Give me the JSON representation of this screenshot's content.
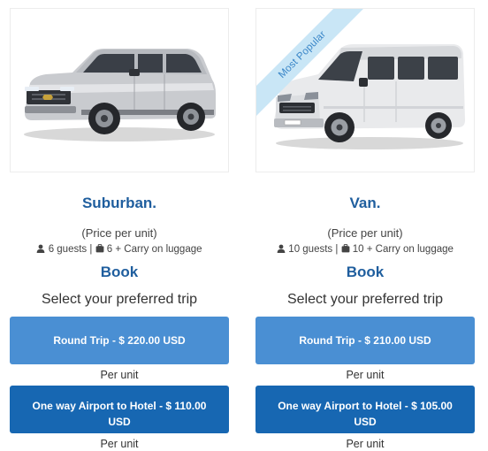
{
  "colors": {
    "title": "#1f5e9e",
    "round_trip_button": "#4a8fd3",
    "one_way_button": "#1767b2",
    "ribbon_bg": "#c9e6f6",
    "ribbon_text": "#3a86c8"
  },
  "icons": {
    "guests": "user-icon",
    "luggage": "suitcase-icon"
  },
  "cards": [
    {
      "title": "Suburban.",
      "price_note": "(Price per unit)",
      "guests": "6 guests",
      "separator": "|",
      "luggage": "6 + Carry on luggage",
      "book_label": "Book",
      "select_label": "Select your preferred trip",
      "round_trip_label": "Round Trip - $ 220.00 USD",
      "round_trip_unit": "Per unit",
      "one_way_label": "One way Airport to Hotel - $ 110.00 USD",
      "one_way_unit": "Per unit"
    },
    {
      "ribbon": "Most Popular",
      "title": "Van.",
      "price_note": "(Price per unit)",
      "guests": "10 guests",
      "separator": "|",
      "luggage": "10 + Carry on luggage",
      "book_label": "Book",
      "select_label": "Select your preferred trip",
      "round_trip_label": "Round Trip - $ 210.00 USD",
      "round_trip_unit": "Per unit",
      "one_way_label": "One way Airport to Hotel - $ 105.00 USD",
      "one_way_unit": "Per unit"
    }
  ]
}
